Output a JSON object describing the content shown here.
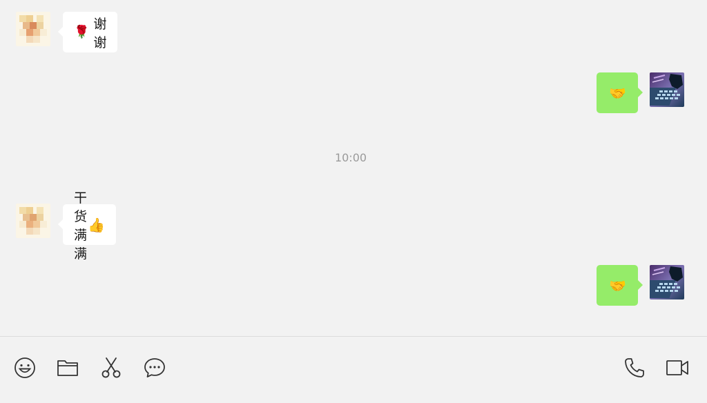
{
  "messages": [
    {
      "side": "left",
      "emoji_lead": "🌹",
      "text": "谢谢",
      "emoji_trail": ""
    },
    {
      "side": "right",
      "text": "🤝"
    },
    {
      "side": "left",
      "emoji_lead": "",
      "text": "干货满满",
      "emoji_trail": "👍"
    },
    {
      "side": "right",
      "text": "🤝"
    }
  ],
  "timestamp": "10:00",
  "toolbar": {
    "left_icons": [
      "emoji-icon",
      "folder-icon",
      "scissors-icon",
      "chat-bubble-icon"
    ],
    "right_icons": [
      "phone-icon",
      "video-camera-icon"
    ]
  },
  "colors": {
    "background": "#f2f2f2",
    "incoming_bubble": "#ffffff",
    "outgoing_bubble": "#95ec69",
    "timestamp": "#9a9a9a"
  }
}
